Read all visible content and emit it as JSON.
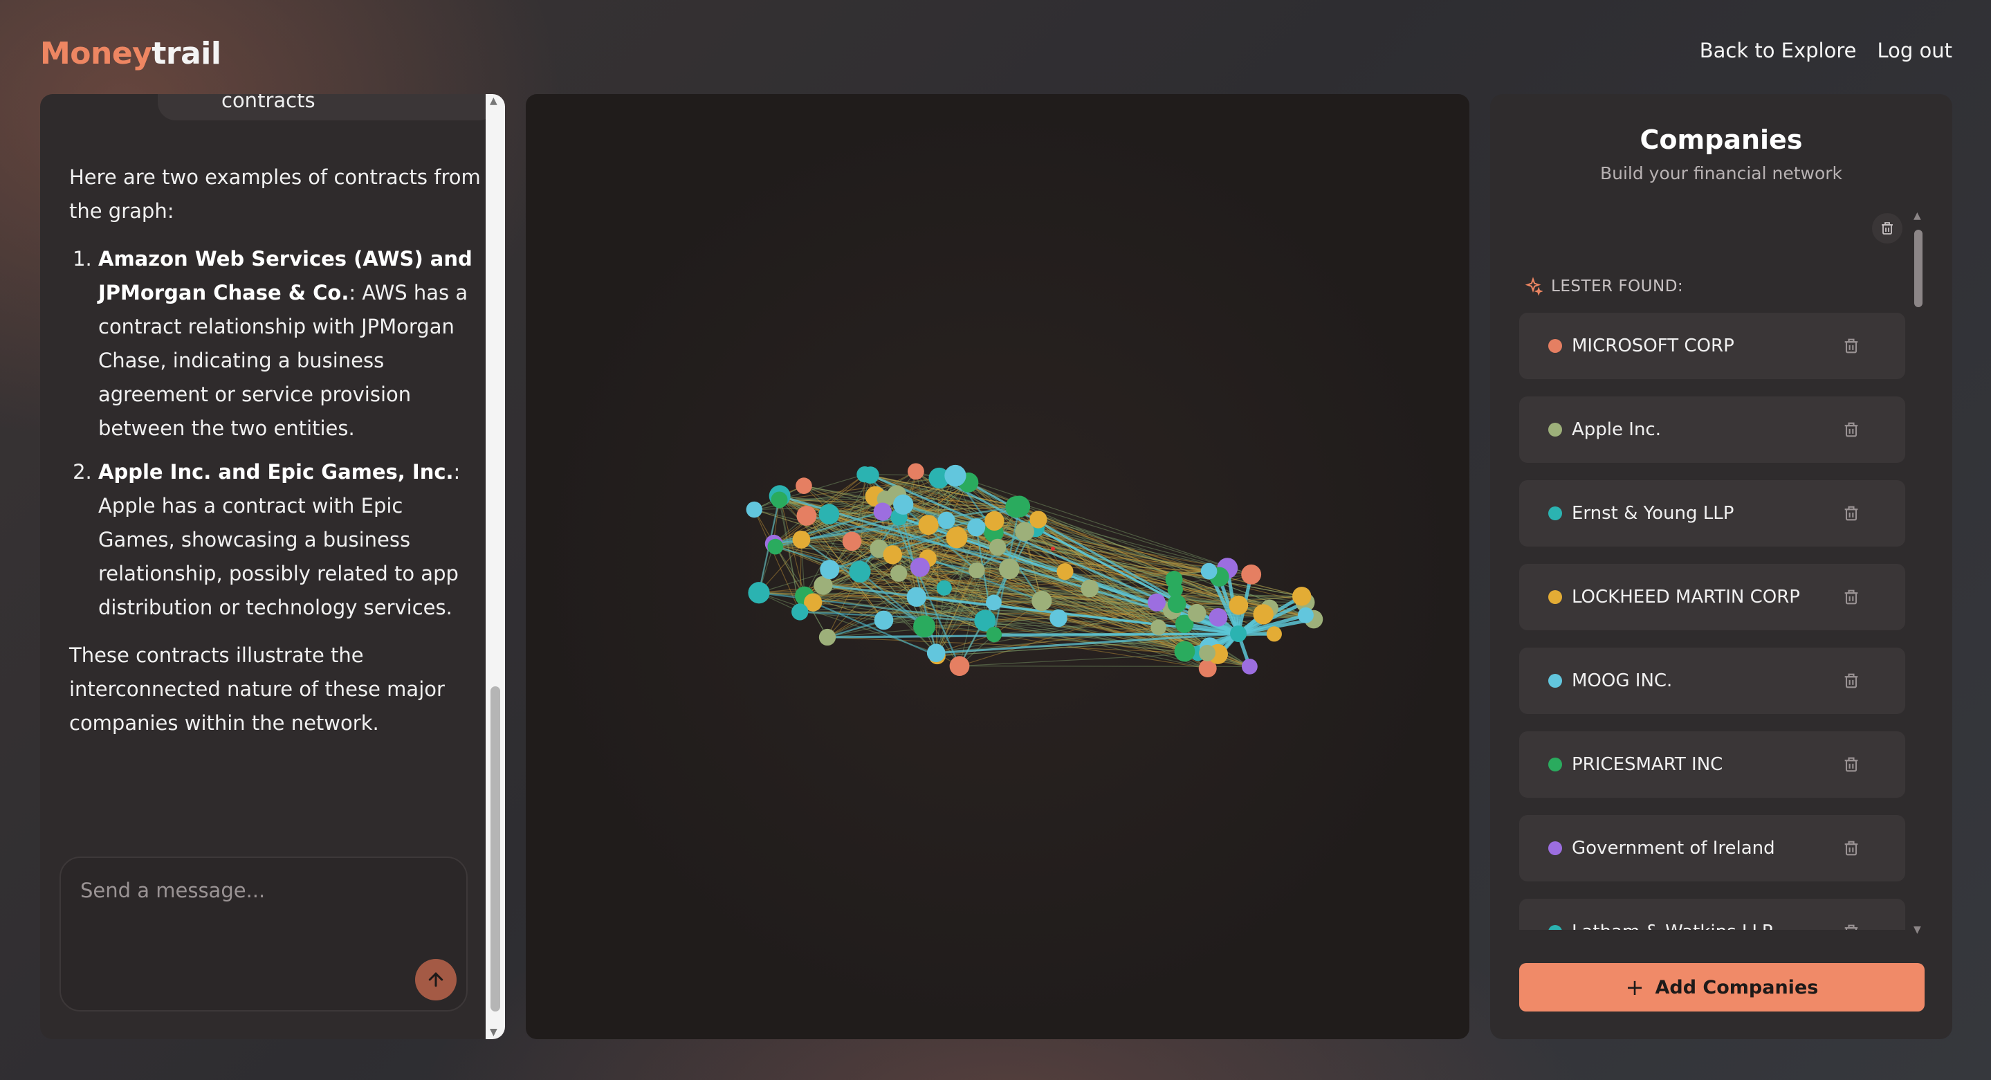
{
  "brand": {
    "part1": "Money",
    "part2": "trail"
  },
  "nav": {
    "back": "Back to Explore",
    "logout": "Log out"
  },
  "chat": {
    "user_msg": "contracts",
    "intro": "Here are two examples of contracts from the graph:",
    "items": [
      {
        "bold": "Amazon Web Services (AWS) and JPMorgan Chase & Co.",
        "text": ": AWS has a contract relationship with JPMorgan Chase, indicating a business agreement or service provision between the two entities."
      },
      {
        "bold": "Apple Inc. and Epic Games, Inc.",
        "text": ": Apple has a contract with Epic Games, showcasing a business relationship, possibly related to app distribution or technology services."
      }
    ],
    "outro": "These contracts illustrate the interconnected nature of these major companies within the network.",
    "input_placeholder": "Send a message..."
  },
  "companies": {
    "title": "Companies",
    "subtitle": "Build your financial network",
    "found_label": "LESTER FOUND:",
    "add_label": "Add Companies",
    "items": [
      {
        "name": "MICROSOFT CORP",
        "color": "#e57f62"
      },
      {
        "name": "Apple Inc.",
        "color": "#9db07a"
      },
      {
        "name": "Ernst & Young LLP",
        "color": "#2bb3b1"
      },
      {
        "name": "LOCKHEED MARTIN CORP",
        "color": "#e3ac35"
      },
      {
        "name": "MOOG INC.",
        "color": "#62c6dd"
      },
      {
        "name": "PRICESMART INC",
        "color": "#2aab5e"
      },
      {
        "name": "Government of Ireland",
        "color": "#9c6ee0"
      },
      {
        "name": "Latham & Watkins LLP",
        "color": "#2bb3b1"
      }
    ]
  }
}
